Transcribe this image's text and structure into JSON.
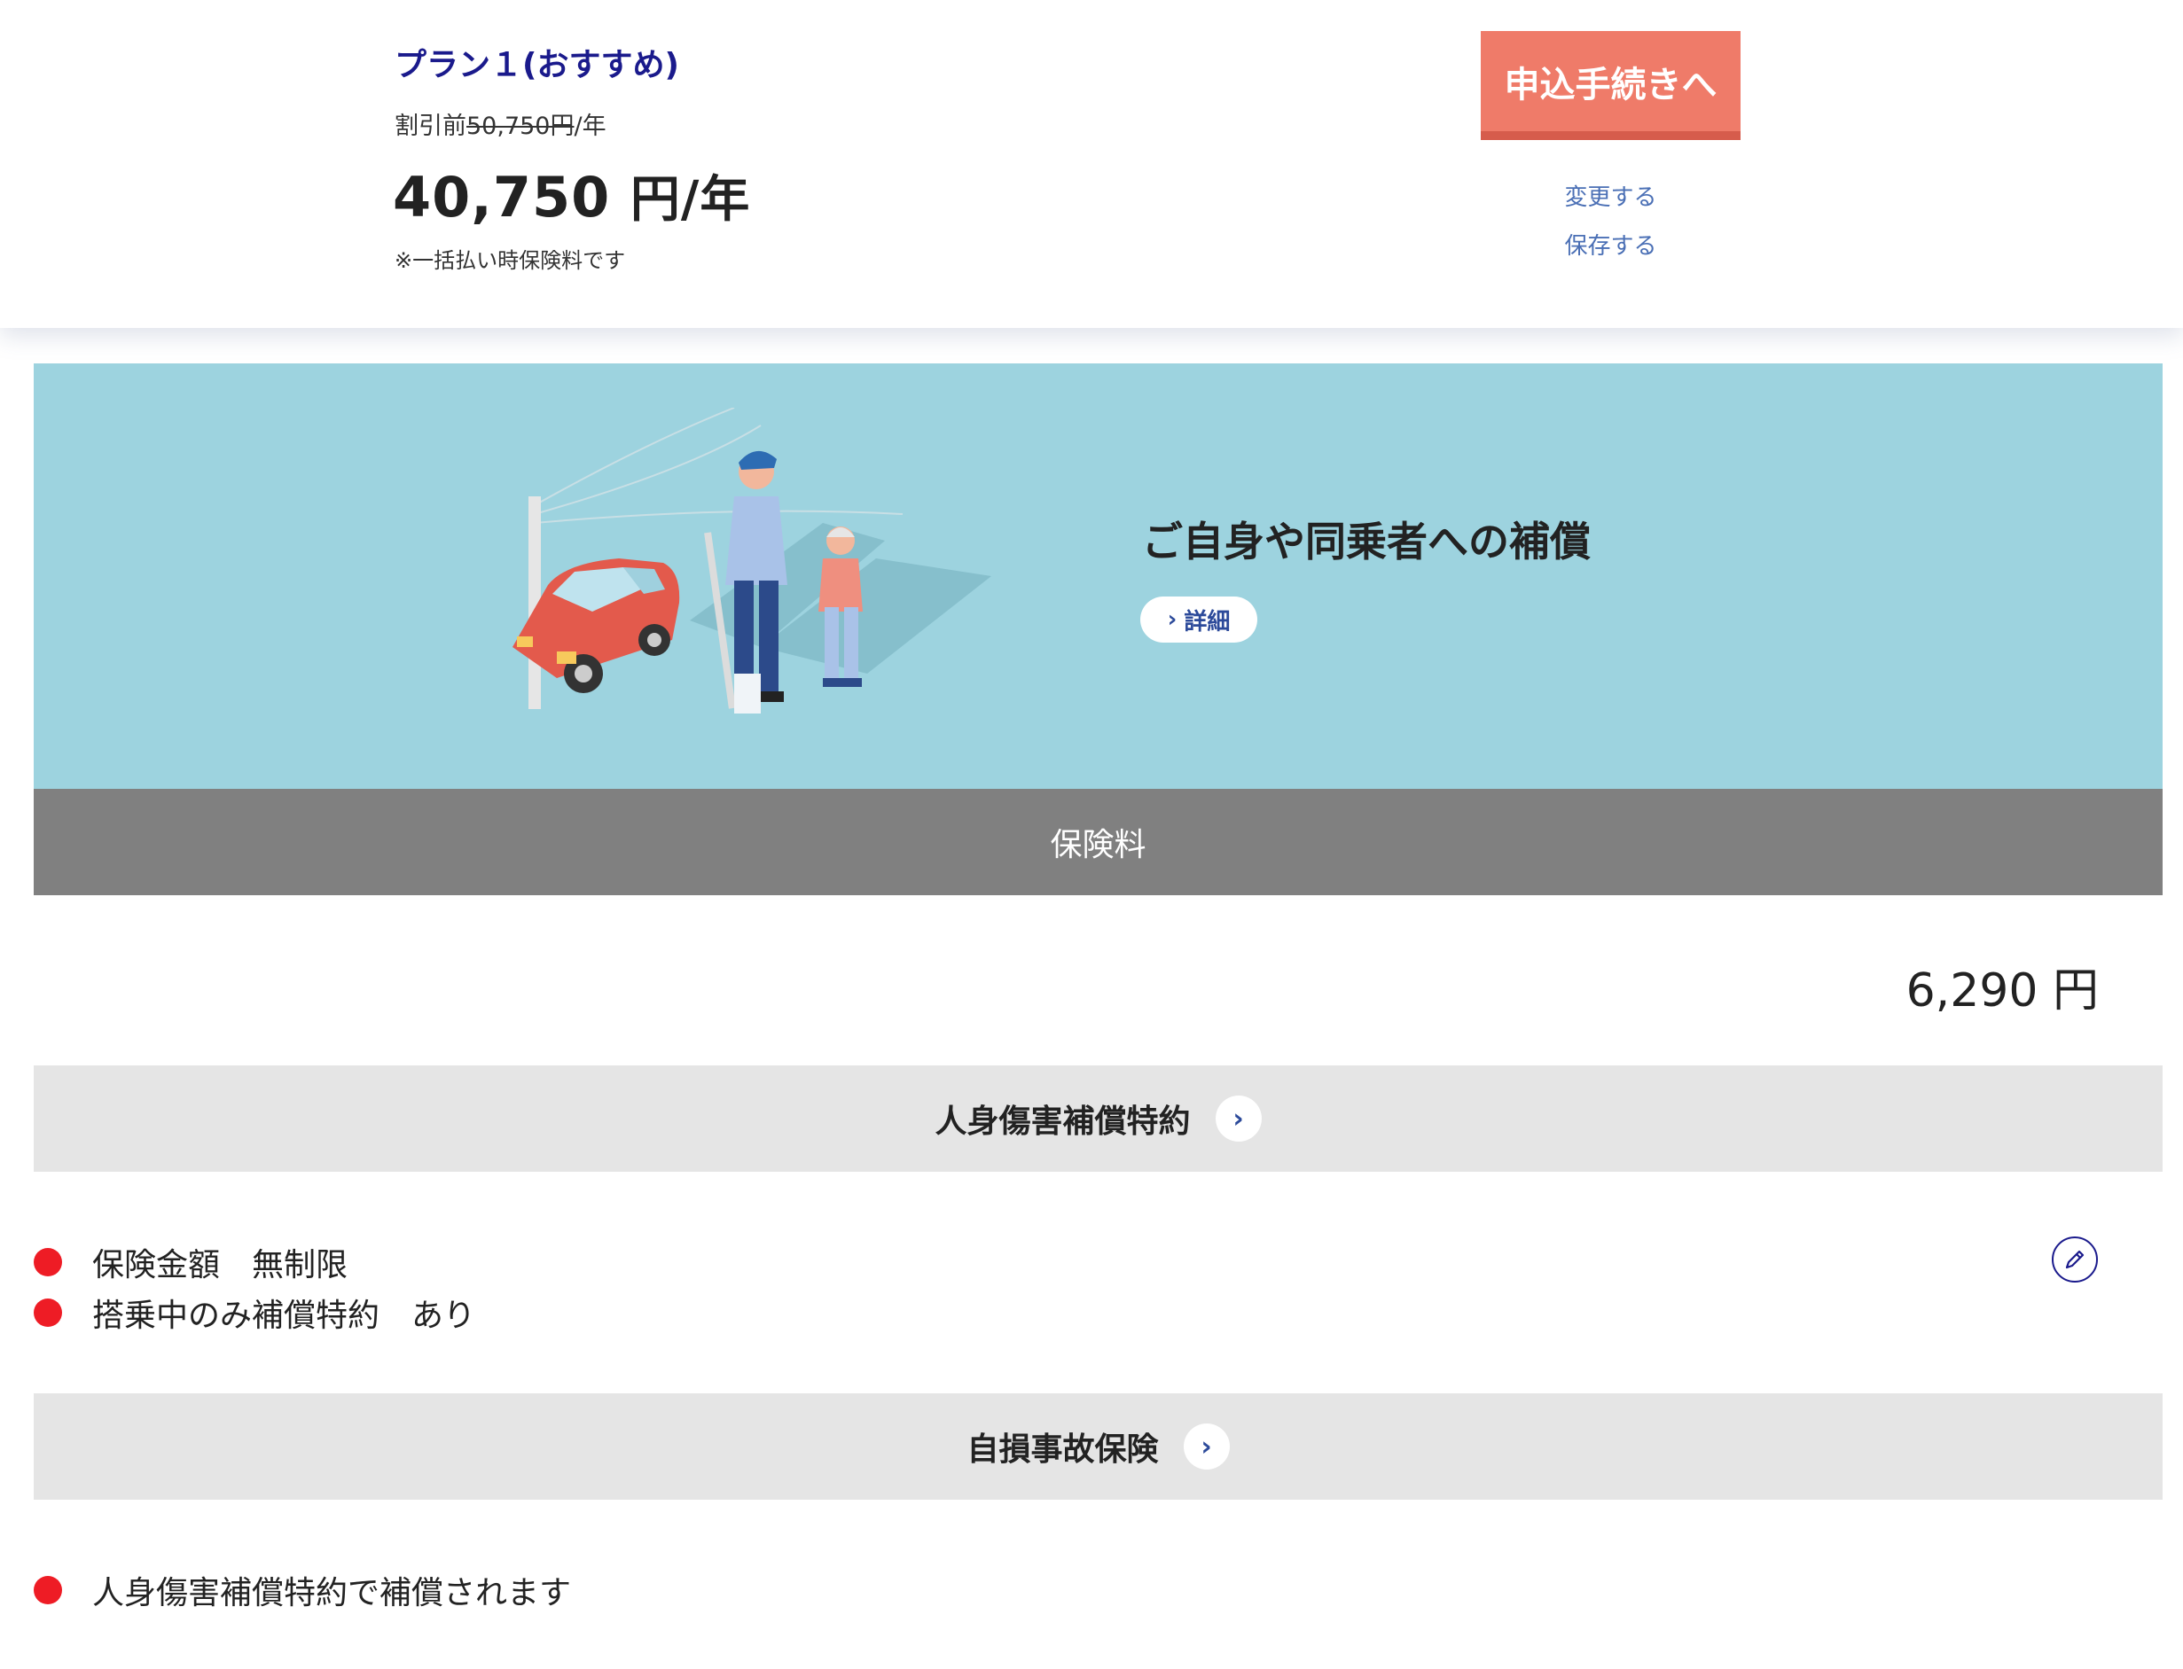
{
  "header": {
    "plan_title": "プラン１(おすすめ)",
    "before_prefix": "割引前",
    "before_amount": "50,750円",
    "before_suffix": "/年",
    "price_amount": "40,750",
    "price_unit": "円/年",
    "price_note": "※一括払い時保険料です",
    "apply_button": "申込手続きへ",
    "change_link": "変更する",
    "save_link": "保存する"
  },
  "banner": {
    "title": "ご自身や同乗者への補償",
    "detail_button": "詳細"
  },
  "premium": {
    "label": "保険料",
    "value": "6,290 円"
  },
  "sections": [
    {
      "title": "人身傷害補償特約",
      "items": [
        "保険金額　無制限",
        "搭乗中のみ補償特約　あり"
      ]
    },
    {
      "title": "自損事故保険",
      "items": [
        "人身傷害補償特約で補償されます"
      ]
    }
  ],
  "colors": {
    "accent_button": "#ef7b69",
    "banner_bg": "#9dd3df",
    "bullet": "#ee1c25",
    "link": "#4a6fb5",
    "plan_title": "#1a1a8c"
  },
  "icons": {
    "detail": "chevron-right-icon",
    "section": "chevron-right-icon",
    "edit": "pencil-icon"
  }
}
